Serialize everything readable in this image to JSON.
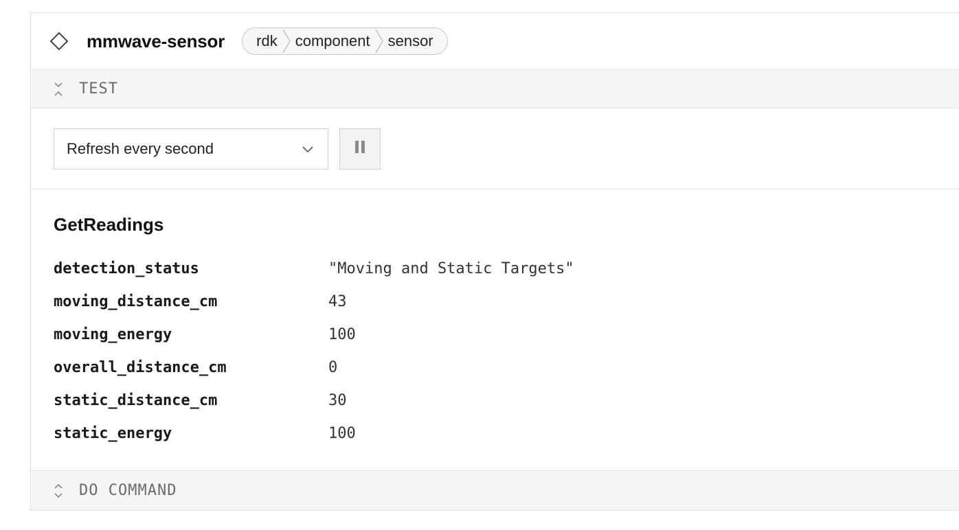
{
  "header": {
    "title": "mmwave-sensor",
    "breadcrumb": [
      "rdk",
      "component",
      "sensor"
    ]
  },
  "test_section": {
    "label": "TEST",
    "refresh_select": {
      "value": "Refresh every second"
    }
  },
  "readings": {
    "title": "GetReadings",
    "rows": [
      {
        "key": "detection_status",
        "value": "\"Moving and Static Targets\""
      },
      {
        "key": "moving_distance_cm",
        "value": "43"
      },
      {
        "key": "moving_energy",
        "value": "100"
      },
      {
        "key": "overall_distance_cm",
        "value": "0"
      },
      {
        "key": "static_distance_cm",
        "value": "30"
      },
      {
        "key": "static_energy",
        "value": "100"
      }
    ]
  },
  "do_command_section": {
    "label": "DO COMMAND"
  },
  "icons": {
    "header": "diamond-icon",
    "test_toggle": "collapse-chevrons-icon",
    "select_arrow": "chevron-down-icon",
    "pause": "pause-icon",
    "do_command_toggle": "expand-chevrons-icon"
  },
  "colors": {
    "border": "#e2e2e2",
    "section_bg": "#f5f5f5",
    "muted_text": "#6b6b6b"
  }
}
